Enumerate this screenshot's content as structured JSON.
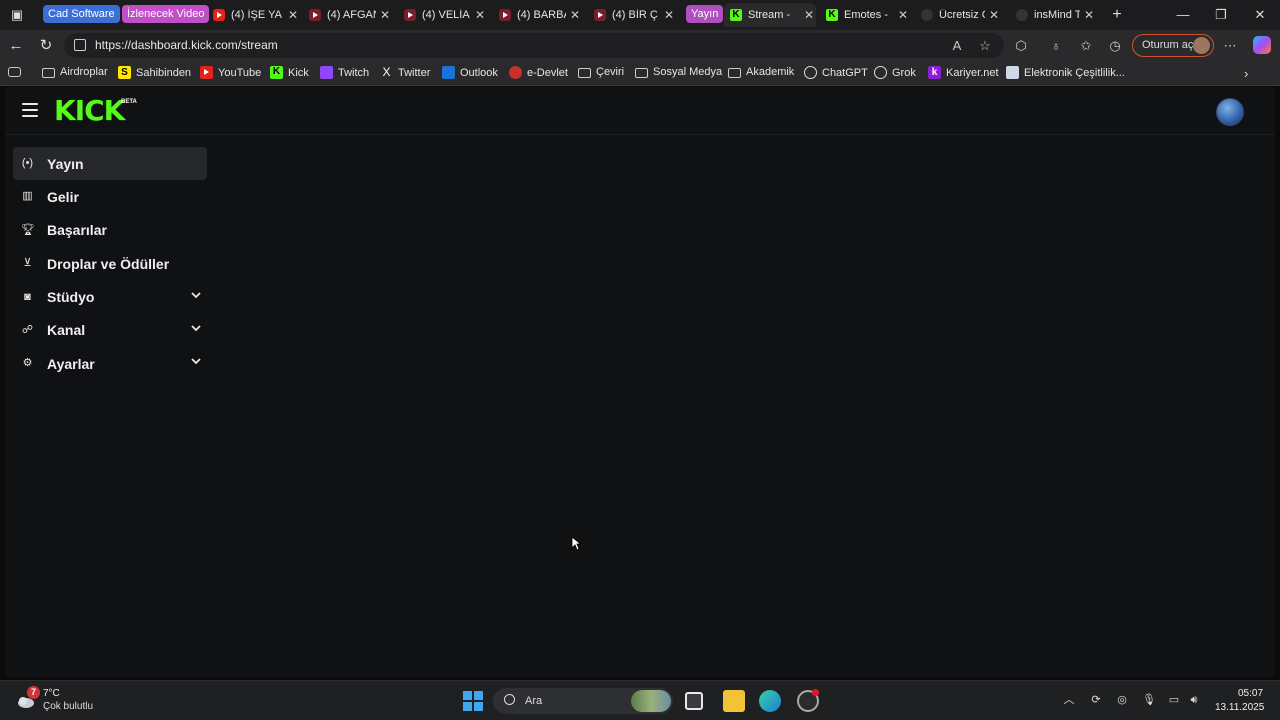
{
  "browser": {
    "group_chips": [
      {
        "label": "Cad Software",
        "color": "#3b6fd6"
      },
      {
        "label": "İzlenecek Video",
        "color": "#c04fc8"
      },
      {
        "label": "Yayın",
        "color": "#b04fbf"
      }
    ],
    "tabs": [
      {
        "title": "(4) İŞE YA",
        "favicon": "youtube-icon"
      },
      {
        "title": "(4) AFGAN",
        "favicon": "youtube-icon"
      },
      {
        "title": "(4) VELİA",
        "favicon": "youtube-icon"
      },
      {
        "title": "(4) BARBA",
        "favicon": "youtube-icon"
      },
      {
        "title": "(4) BİR Ç",
        "favicon": "youtube-icon"
      },
      {
        "title": "Stream - ",
        "favicon": "kick-icon",
        "active": true
      },
      {
        "title": "Emotes - ",
        "favicon": "kick-icon"
      },
      {
        "title": "Ücretsiz C",
        "favicon": "generic-icon"
      },
      {
        "title": "insMind T",
        "favicon": "generic-icon"
      }
    ],
    "url": "https://dashboard.kick.com/stream",
    "signin_label": "Oturum aç",
    "bookmarks": [
      {
        "label": "Airdroplar",
        "icon": "folder-icon"
      },
      {
        "label": "Sahibinden",
        "icon": "sahibinden-icon"
      },
      {
        "label": "YouTube",
        "icon": "youtube-icon"
      },
      {
        "label": "Kick",
        "icon": "kick-icon"
      },
      {
        "label": "Twitch",
        "icon": "twitch-icon"
      },
      {
        "label": "Twitter",
        "icon": "x-icon"
      },
      {
        "label": "Outlook",
        "icon": "outlook-icon"
      },
      {
        "label": "e-Devlet",
        "icon": "edevlet-icon"
      },
      {
        "label": "Çeviri",
        "icon": "folder-icon"
      },
      {
        "label": "Sosyal Medya",
        "icon": "folder-icon"
      },
      {
        "label": "Akademik",
        "icon": "folder-icon"
      },
      {
        "label": "ChatGPT",
        "icon": "chatgpt-icon"
      },
      {
        "label": "Grok",
        "icon": "grok-icon"
      },
      {
        "label": "Kariyer.net",
        "icon": "kariyer-icon"
      },
      {
        "label": "Elektronik Çeşitlilik...",
        "icon": "page-icon"
      }
    ]
  },
  "app": {
    "logo_text": "KICK",
    "logo_badge": "BETA",
    "sidebar": [
      {
        "label": "Yayın",
        "icon": "broadcast-icon",
        "active": true,
        "expandable": false
      },
      {
        "label": "Gelir",
        "icon": "chart-icon",
        "active": false,
        "expandable": false
      },
      {
        "label": "Başarılar",
        "icon": "trophy-icon",
        "active": false,
        "expandable": false
      },
      {
        "label": "Droplar ve Ödüller",
        "icon": "gift-icon",
        "active": false,
        "expandable": false
      },
      {
        "label": "Stüdyo",
        "icon": "studio-icon",
        "active": false,
        "expandable": true
      },
      {
        "label": "Kanal",
        "icon": "users-icon",
        "active": false,
        "expandable": true
      },
      {
        "label": "Ayarlar",
        "icon": "gear-icon",
        "active": false,
        "expandable": true
      }
    ]
  },
  "taskbar": {
    "weather_badge": "7",
    "temperature": "7°C",
    "weather_desc": "Çok bulutlu",
    "search_placeholder": "Ara",
    "time": "05:07",
    "date": "13.11.2025"
  },
  "colors": {
    "kick_green": "#53fc18",
    "page_bg": "#101113",
    "active_item_bg": "#25272b"
  }
}
